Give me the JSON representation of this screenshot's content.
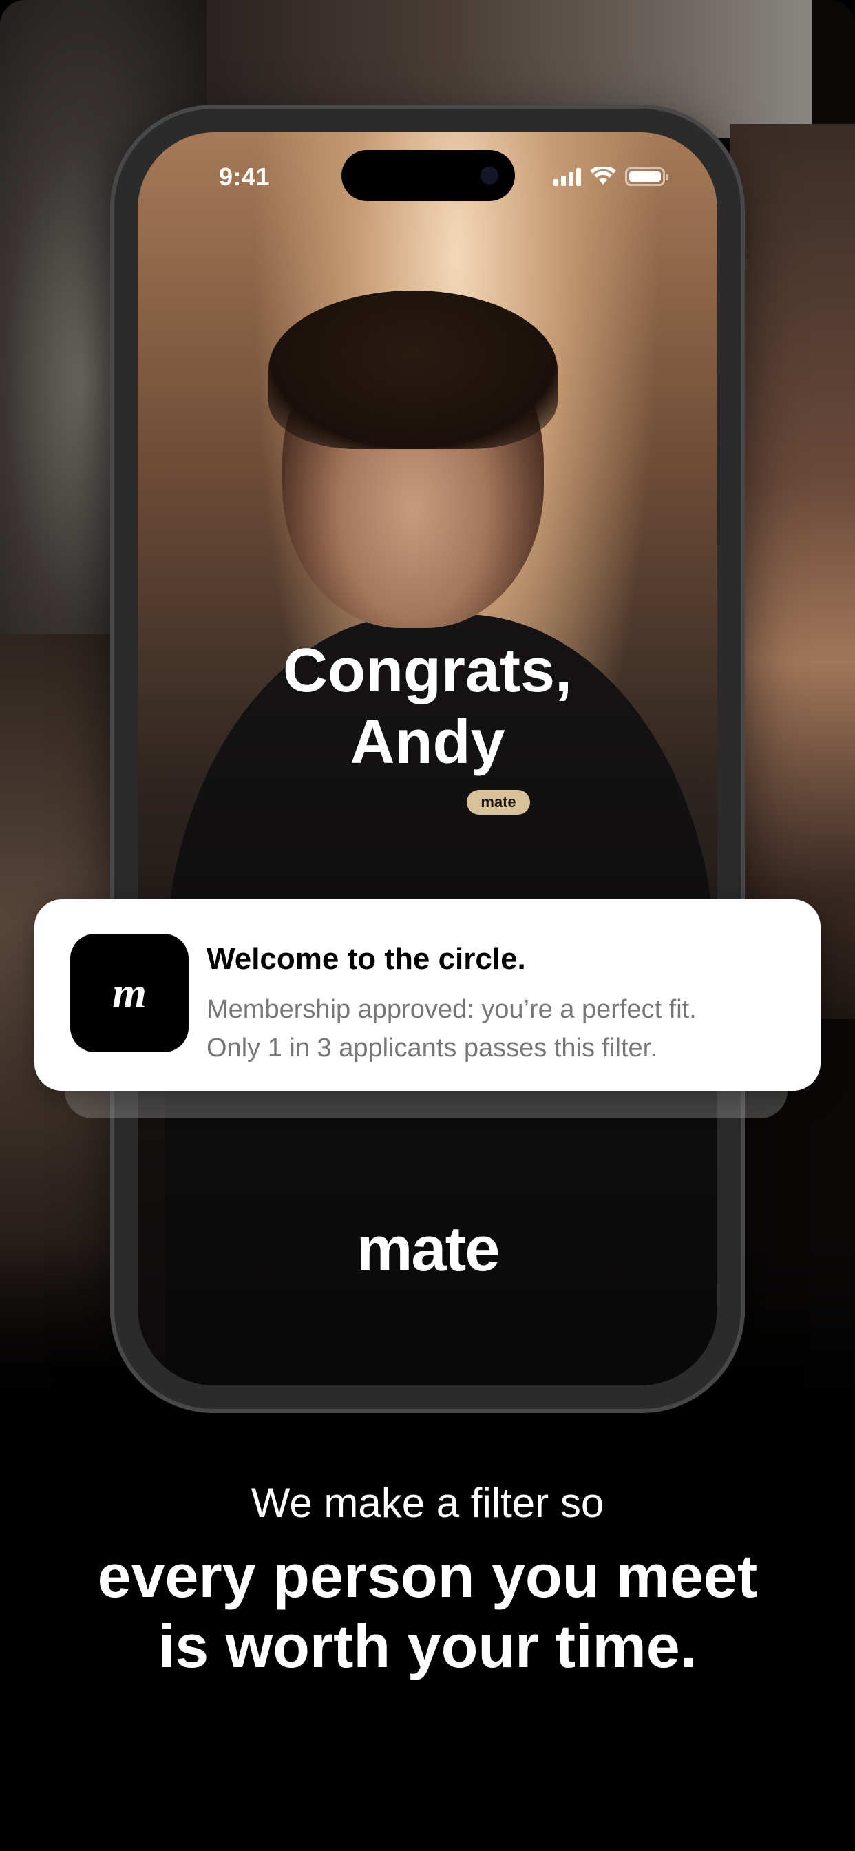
{
  "status_bar": {
    "time": "9:41"
  },
  "hero": {
    "line1": "Congrats,",
    "line2": "Andy",
    "shirt_logo": "mate"
  },
  "app_logo": "mate",
  "notification": {
    "icon_glyph": "m",
    "title": "Welcome to the circle.",
    "line1": "Membership approved: you’re a perfect fit.",
    "line2": "Only 1 in 3 applicants passes this filter."
  },
  "caption": {
    "lead": "We make a filter so",
    "main_line1": "every person you meet",
    "main_line2": "is worth your time."
  },
  "colors": {
    "background": "#000000",
    "notification_bg": "#ffffff",
    "text_light": "#ffffff",
    "notification_body": "#777777"
  }
}
